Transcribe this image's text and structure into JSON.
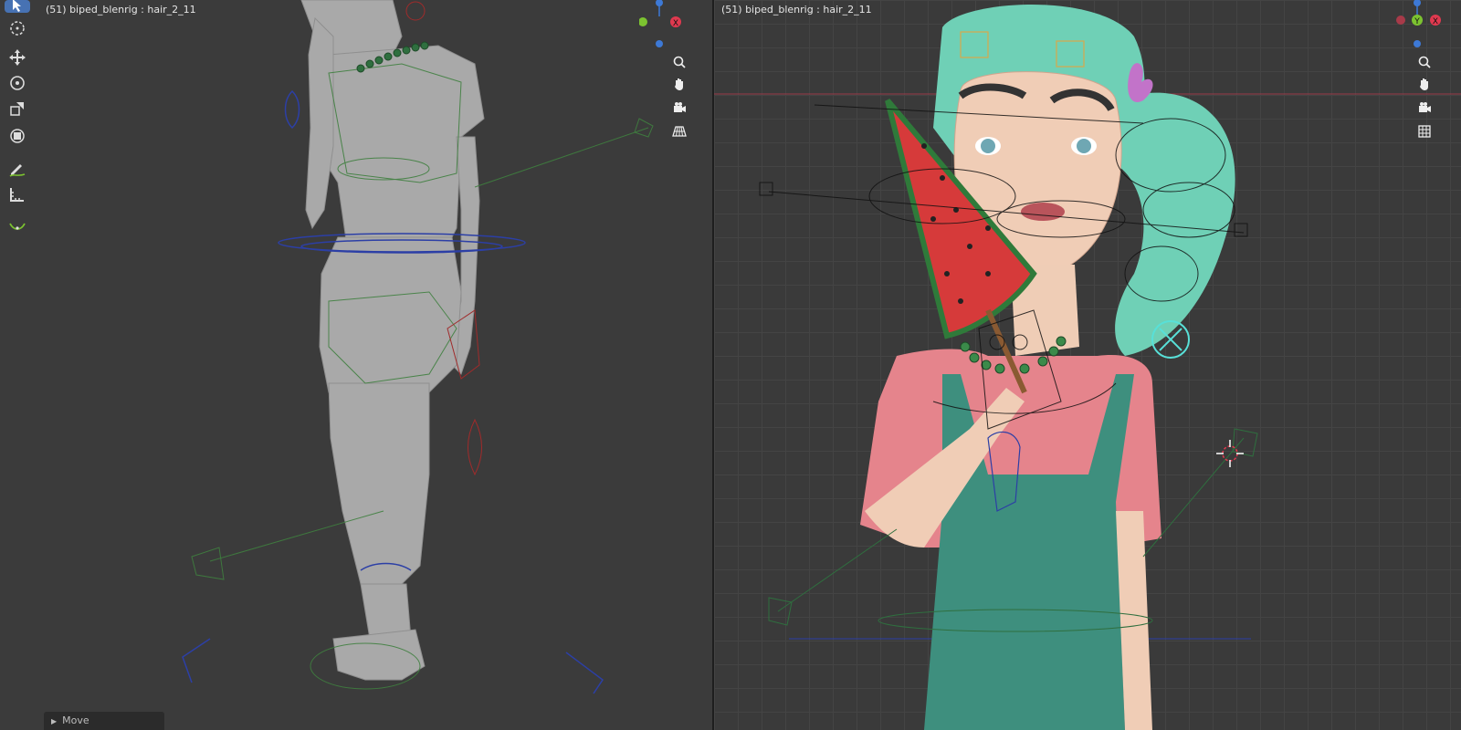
{
  "viewports": {
    "left": {
      "object_label": "(51) biped_blenrig : hair_2_11"
    },
    "right": {
      "object_label": "(51) biped_blenrig : hair_2_11"
    }
  },
  "gizmo": {
    "x_label": "X",
    "y_label": "Y"
  },
  "toolbar": {
    "tools": [
      "select-box-icon",
      "cursor-icon",
      "move-icon",
      "rotate-icon",
      "scale-icon",
      "transform-icon",
      "annotate-icon",
      "measure-icon",
      "pose-relax-icon"
    ]
  },
  "nav_buttons": [
    "zoom-icon",
    "hand-pan-icon",
    "camera-icon",
    "grid-perspective-icon"
  ],
  "last_operator": {
    "label": "Move"
  },
  "colors": {
    "accent": "#4772b3",
    "axis_x": "#e0394f",
    "axis_y": "#7cc330",
    "axis_z": "#3d79d6"
  }
}
